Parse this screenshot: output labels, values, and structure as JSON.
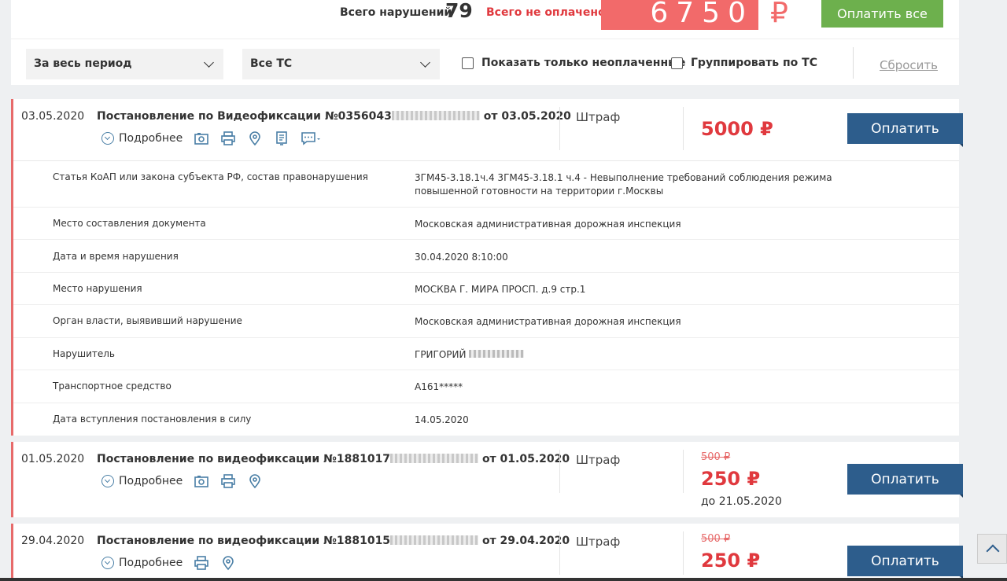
{
  "summary": {
    "total_label": "Всего нарушений",
    "total_count": "79",
    "unpaid_label": "Всего не оплачено",
    "unpaid_amount": "6750",
    "currency": "₽",
    "pay_all_label": "Оплатить все"
  },
  "filters": {
    "period": "За весь период",
    "vehicle": "Все ТС",
    "only_unpaid_label": "Показать только неоплаченные",
    "group_label": "Группировать по ТС",
    "reset_label": "Сбросить"
  },
  "fines": [
    {
      "date": "03.05.2020",
      "title_prefix": "Постановление по Видеофиксации №0356043",
      "title_suffix": "от 03.05.2020",
      "more_label": "Подробнее",
      "type": "Штраф",
      "price": "5000 ₽",
      "pay_label": "Оплатить"
    },
    {
      "date": "01.05.2020",
      "title_prefix": "Постановление по видеофиксации №1881017",
      "title_suffix": "от 01.05.2020",
      "more_label": "Подробнее",
      "type": "Штраф",
      "old_price": "500 ₽",
      "price": "250 ₽",
      "due": "до 21.05.2020",
      "pay_label": "Оплатить"
    },
    {
      "date": "29.04.2020",
      "title_prefix": "Постановление по видеофиксации №1881015",
      "title_suffix": "от 29.04.2020",
      "more_label": "Подробнее",
      "type": "Штраф",
      "old_price": "500 ₽",
      "price": "250 ₽",
      "pay_label": "Оплатить"
    }
  ],
  "details": [
    {
      "k": "Статья КоАП или закона субъекта РФ, состав правонарушения",
      "v": "3ГМ45-3.18.1ч.4 3ГМ45-3.18.1 ч.4 - Невыполнение требований соблюдения режима повышенной готовности на территории г.Москвы"
    },
    {
      "k": "Место составления документа",
      "v": "Московская административная дорожная инспекция"
    },
    {
      "k": "Дата и время нарушения",
      "v": "30.04.2020 8:10:00"
    },
    {
      "k": "Место нарушения",
      "v": "МОСКВА Г. МИРА ПРОСП. д.9 стр.1"
    },
    {
      "k": "Орган власти, выявивший нарушение",
      "v": "Московская административная дорожная инспекция"
    },
    {
      "k": "Нарушитель",
      "v": "ГРИГОРИЙ"
    },
    {
      "k": "Транспортное средство",
      "v": "А161*****"
    },
    {
      "k": "Дата вступления постановления в силу",
      "v": "14.05.2020"
    }
  ],
  "colors": {
    "accent_red": "#e0393e",
    "pay_blue": "#2d5d8c",
    "pay_all_green": "#6db04d"
  }
}
